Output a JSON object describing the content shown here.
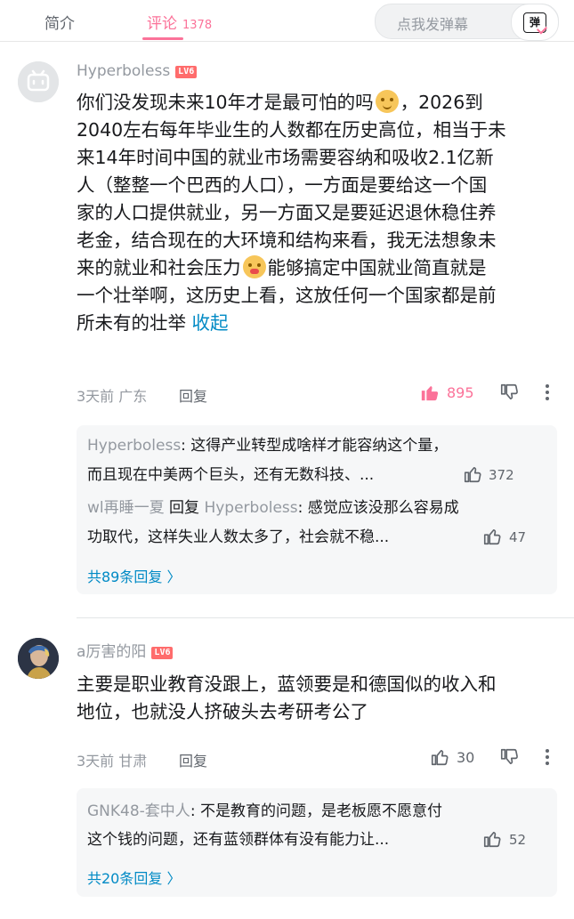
{
  "tabs": {
    "intro": "简介",
    "comments": "评论",
    "comments_count": "1378",
    "danmaku_placeholder": "点我发弹幕",
    "danmaku_icon": "弹"
  },
  "comments": [
    {
      "username": "Hyperboless",
      "level": "LV6",
      "lines": [
        "你们没发现未来10年才是最可怕的吗",
        "，2026到",
        "2040左右每年毕业生的人数都在历史高位，相当于未",
        "来14年时间中国的就业市场需要容纳和吸收2.1亿新",
        "人（整整一个巴西的人口），一方面是要给这一个国",
        "家的人口提供就业，另一方面又是要延迟退休稳住养",
        "老金，结合现在的大环境和结构来看，我无法想象未",
        "来的就业和社会压力",
        "能够搞定中国就业简直就是",
        "一个壮举啊，这历史上看，这放任何一个国家都是前",
        "所未有的壮举 "
      ],
      "collapse": "收起",
      "time_location": "3天前 广东",
      "reply_label": "回复",
      "likes": "895",
      "sub_replies": [
        {
          "name": "Hyperboless",
          "text1": ": 这得产业转型成啥样才能容纳这个量，",
          "text2": "而且现在中美两个巨头，还有无数科技、...",
          "likes": "372"
        },
        {
          "name_prefix": "wl再睡一夏",
          "reply_word": " 回复 ",
          "name": "Hyperboless",
          "text1": ": 感觉应该没那么容易成",
          "text2": "功取代，这样失业人数太多了，社会就不稳...",
          "likes": "47"
        }
      ],
      "more_replies": "共89条回复 〉"
    },
    {
      "username": "a厉害的阳",
      "level": "LV6",
      "lines": [
        "主要是职业教育没跟上，蓝领要是和德国似的收入和",
        "地位，也就没人挤破头去考研考公了"
      ],
      "time_location": "3天前 甘肃",
      "reply_label": "回复",
      "likes": "30",
      "sub_replies": [
        {
          "name": "GNK48-套中人",
          "text1": ": 不是教育的问题，是老板愿不愿意付",
          "text2": "这个钱的问题，还有蓝领群体有没有能力让...",
          "likes": "52"
        }
      ],
      "more_replies": "共20条回复 〉"
    }
  ],
  "colors": {
    "accent": "#fb7299",
    "link": "#008ac5",
    "level_badge": "#ff6c6c"
  }
}
